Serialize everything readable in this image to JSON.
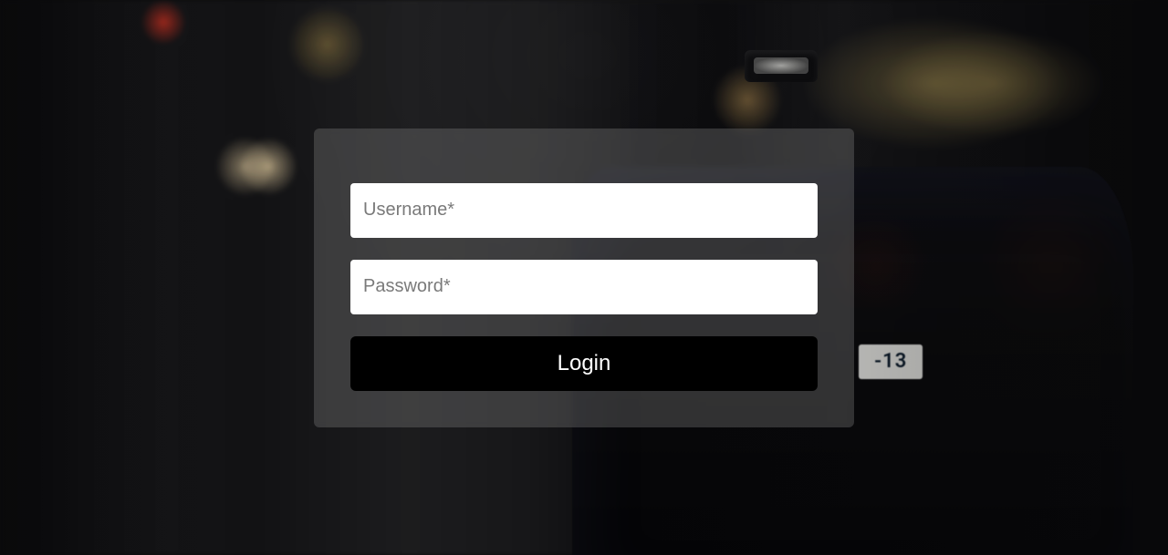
{
  "form": {
    "username_placeholder": "Username*",
    "password_placeholder": "Password*",
    "login_label": "Login"
  }
}
